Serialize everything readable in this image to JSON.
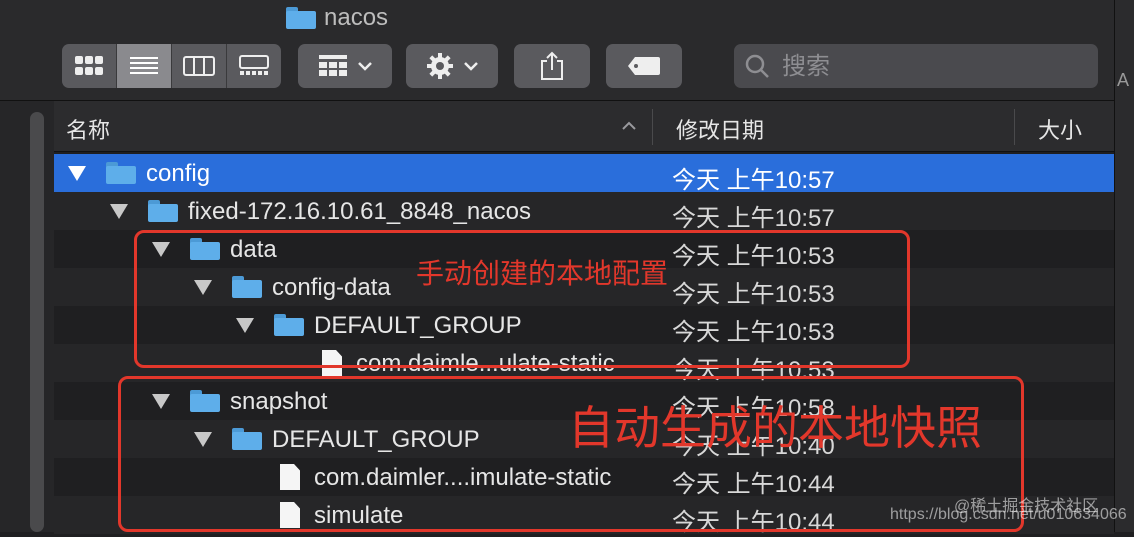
{
  "window": {
    "title": "nacos"
  },
  "toolbar": {
    "search_placeholder": "搜索",
    "view_modes": [
      "icon-view",
      "list-view",
      "column-view",
      "gallery-view"
    ]
  },
  "columns": {
    "name": "名称",
    "date": "修改日期",
    "size": "大小"
  },
  "rows": [
    {
      "name": "config",
      "date": "今天 上午10:57",
      "type": "folder",
      "expanded": true
    },
    {
      "name": "fixed-172.16.10.61_8848_nacos",
      "date": "今天 上午10:57",
      "type": "folder",
      "expanded": true
    },
    {
      "name": "data",
      "date": "今天 上午10:53",
      "type": "folder",
      "expanded": true
    },
    {
      "name": "config-data",
      "date": "今天 上午10:53",
      "type": "folder",
      "expanded": true
    },
    {
      "name": "DEFAULT_GROUP",
      "date": "今天 上午10:53",
      "type": "folder",
      "expanded": true
    },
    {
      "name": "com.daimle...ulate-static",
      "date": "今天 上午10:53",
      "type": "file"
    },
    {
      "name": "snapshot",
      "date": "今天 上午10:58",
      "type": "folder",
      "expanded": true
    },
    {
      "name": "DEFAULT_GROUP",
      "date": "今天 上午10:40",
      "type": "folder",
      "expanded": true
    },
    {
      "name": "com.daimler....imulate-static",
      "date": "今天 上午10:44",
      "type": "file"
    },
    {
      "name": "simulate",
      "date": "今天 上午10:44",
      "type": "file"
    }
  ],
  "annotations": {
    "manual": "手动创建的本地配置",
    "auto": "自动生成的本地快照"
  },
  "watermark": {
    "line1": "@稀土掘金技术社区",
    "line2": "https://blog.csdn.net/u010634066"
  },
  "edge_glyph": "A",
  "colors": {
    "selection": "#2a6edb",
    "folder": "#5eaeea",
    "annotation": "#e2372b"
  }
}
